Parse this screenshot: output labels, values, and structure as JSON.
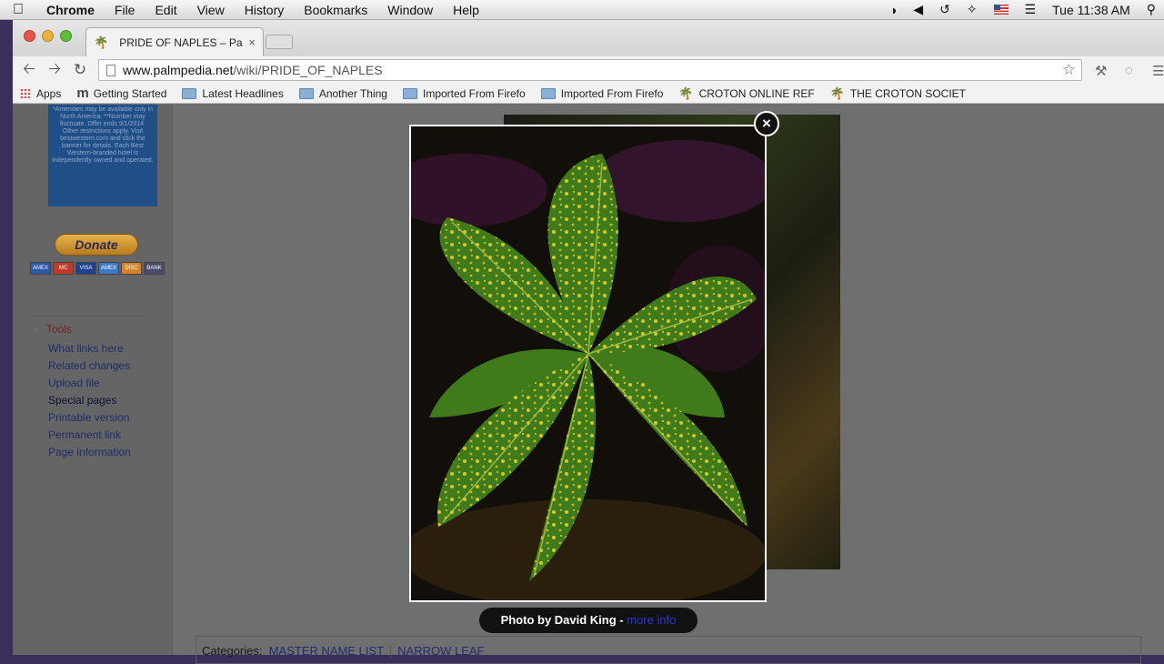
{
  "menubar": {
    "app": "Chrome",
    "items": [
      "File",
      "Edit",
      "View",
      "History",
      "Bookmarks",
      "Window",
      "Help"
    ],
    "clock": "Tue 11:38 AM"
  },
  "tab": {
    "title": "PRIDE OF NAPLES – Palmpe",
    "close": "×"
  },
  "address": {
    "domain": "www.palmpedia.net",
    "path": "/wiki/PRIDE_OF_NAPLES"
  },
  "bookmarks": {
    "apps": "Apps",
    "getting_started": "Getting Started",
    "latest": "Latest Headlines",
    "another": "Another Thing",
    "imported1": "Imported From Firefo",
    "imported2": "Imported From Firefo",
    "croton_online": "CROTON ONLINE REF",
    "croton_society": "THE CROTON SOCIET"
  },
  "sidebar": {
    "ad_text": "*Amenities may be available only in North America. **Number may fluctuate. Offer ends 9/1/2014. Other restrictions apply. Visit bestwestern.com and click the banner for details. Each Best Western-branded hotel is independently owned and operated.",
    "donate": "Donate",
    "cards": [
      "AMEX",
      "MC",
      "VISA",
      "AMEX",
      "DISC",
      "BANK"
    ],
    "tools_heading": "Tools",
    "tools": [
      "What links here",
      "Related changes",
      "Upload file",
      "Special pages",
      "Printable version",
      "Permanent link",
      "Page information"
    ]
  },
  "categories": {
    "label": "Categories:",
    "items": [
      "MASTER NAME LIST",
      "NARROW LEAF"
    ]
  },
  "lightbox": {
    "close": "×",
    "caption": "Photo by David King - ",
    "more_info": "more info"
  },
  "colors": {
    "overlay": "#6f6f6f",
    "leaf_green": "#4f8a1e",
    "leaf_yellow": "#e8d21a",
    "link": "#1e2d6b"
  }
}
